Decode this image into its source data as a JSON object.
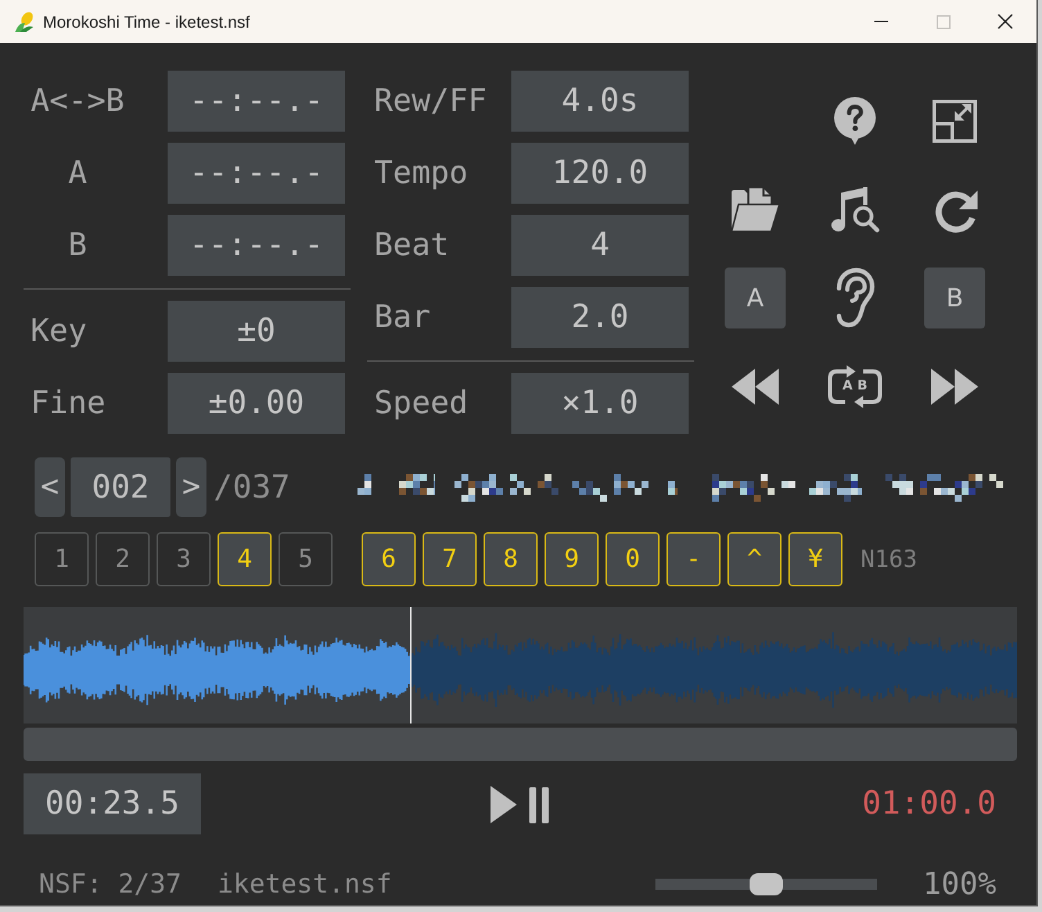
{
  "window": {
    "title": "Morokoshi Time - iketest.nsf",
    "maximize_disabled": true
  },
  "loop_points": [
    {
      "label": "A<->B",
      "value": "--:--.-"
    },
    {
      "label": "A",
      "value": "--:--.-"
    },
    {
      "label": "B",
      "value": "--:--.-"
    }
  ],
  "pitch": [
    {
      "label": "Key",
      "value": "±0"
    },
    {
      "label": "Fine",
      "value": "±0.00"
    }
  ],
  "rhythm": [
    {
      "label": "Rew/FF",
      "value": "4.0s"
    },
    {
      "label": "Tempo",
      "value": "120.0"
    },
    {
      "label": "Beat",
      "value": "4"
    },
    {
      "label": "Bar",
      "value": "2.0"
    }
  ],
  "speed": {
    "label": "Speed",
    "value": "×1.0"
  },
  "marker_buttons": {
    "a": "A",
    "b": "B"
  },
  "loop_button": {
    "label": "A B"
  },
  "track": {
    "prev": "<",
    "number": "002",
    "next": ">",
    "total": "/037"
  },
  "channel_groups": [
    {
      "buttons": [
        {
          "label": "1",
          "on": false
        },
        {
          "label": "2",
          "on": false
        },
        {
          "label": "3",
          "on": false
        },
        {
          "label": "4",
          "on": true
        },
        {
          "label": "5",
          "on": false
        }
      ]
    },
    {
      "buttons": [
        {
          "label": "6",
          "on": true
        },
        {
          "label": "7",
          "on": true
        },
        {
          "label": "8",
          "on": true
        },
        {
          "label": "9",
          "on": true
        },
        {
          "label": "0",
          "on": true
        },
        {
          "label": "-",
          "on": true
        },
        {
          "label": "^",
          "on": true
        },
        {
          "label": "¥",
          "on": true
        }
      ]
    }
  ],
  "chip": "N163",
  "waveform": {
    "level": 0.39
  },
  "elapsed": "00:23.5",
  "duration": "01:00.0",
  "status": {
    "track_info": "NSF: 2/37",
    "file_name": "iketest.nsf"
  },
  "volume": {
    "level": 0.5,
    "reading": "100%"
  }
}
